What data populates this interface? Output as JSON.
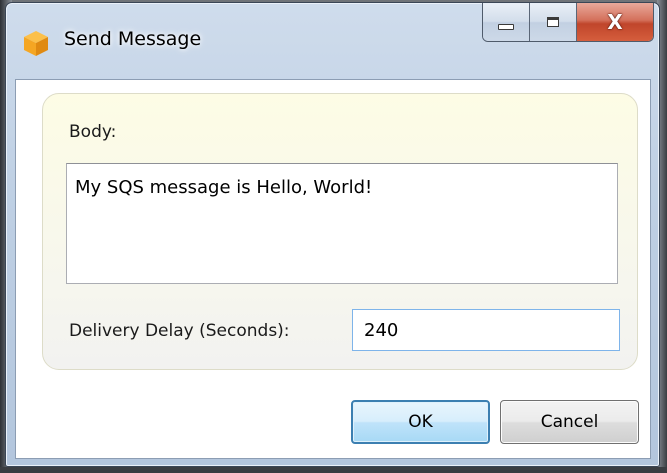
{
  "window": {
    "title": "Send Message",
    "icon": "amazon-box-icon",
    "caption": {
      "minimize_icon": "minimize-icon",
      "maximize_icon": "maximize-icon",
      "close_glyph": "X"
    }
  },
  "form": {
    "body_label": "Body:",
    "body_value": "My SQS message is Hello, World!",
    "delay_label": "Delivery Delay (Seconds):",
    "delay_value": "240"
  },
  "buttons": {
    "ok": "OK",
    "cancel": "Cancel"
  },
  "colors": {
    "accent": "#3c7fb1",
    "panel": "#fdfce5",
    "close": "#c0452b",
    "icon": "#f5a623"
  }
}
